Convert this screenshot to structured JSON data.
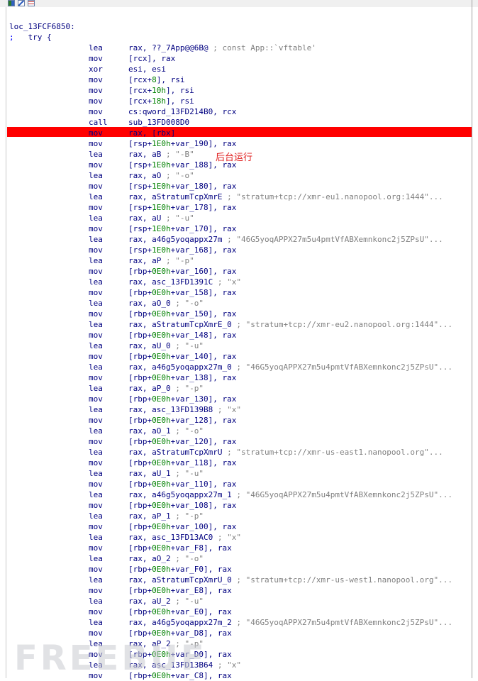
{
  "toolbar": {
    "icons": [
      "graph-view-icon",
      "chart-icon",
      "text-view-icon"
    ]
  },
  "colors": {
    "highlight": "#ff0000",
    "mnemonic": "#000080",
    "number": "#008000",
    "comment": "#808080",
    "annotation": "#e02020"
  },
  "listing": {
    "label": "loc_13FCF6850:",
    "try_semicolon": ";",
    "try_text": "try {",
    "instructions": [
      {
        "mn": "lea",
        "op": "rax, ??_7App@@6B@",
        "cmt": " ; const App::`vftable'"
      },
      {
        "mn": "mov",
        "op": "[rcx], rax",
        "cmt": ""
      },
      {
        "mn": "xor",
        "op": "esi, esi",
        "cmt": ""
      },
      {
        "mn": "mov",
        "op": "[rcx+8], rsi",
        "cmt": ""
      },
      {
        "mn": "mov",
        "op": "[rcx+10h], rsi",
        "cmt": ""
      },
      {
        "mn": "mov",
        "op": "[rcx+18h], rsi",
        "cmt": ""
      },
      {
        "mn": "mov",
        "op": "cs:qword_13FD214B0, rcx",
        "cmt": ""
      },
      {
        "mn": "call",
        "op": "sub_13FD008D0",
        "cmt": ""
      },
      {
        "mn": "mov",
        "op": "rax, [rbx]",
        "cmt": ""
      },
      {
        "mn": "mov",
        "op": "[rsp+1E0h+var_190], rax",
        "cmt": ""
      },
      {
        "mn": "lea",
        "op": "rax, aB",
        "cmt": " ; \"-B\""
      },
      {
        "mn": "mov",
        "op": "[rsp+1E0h+var_188], rax",
        "cmt": ""
      },
      {
        "mn": "lea",
        "op": "rax, aO",
        "cmt": " ; \"-o\""
      },
      {
        "mn": "mov",
        "op": "[rsp+1E0h+var_180], rax",
        "cmt": ""
      },
      {
        "mn": "lea",
        "op": "rax, aStratumTcpXmrE",
        "cmt": " ; \"stratum+tcp://xmr-eu1.nanopool.org:1444\"..."
      },
      {
        "mn": "mov",
        "op": "[rsp+1E0h+var_178], rax",
        "cmt": ""
      },
      {
        "mn": "lea",
        "op": "rax, aU",
        "cmt": " ; \"-u\""
      },
      {
        "mn": "mov",
        "op": "[rsp+1E0h+var_170], rax",
        "cmt": ""
      },
      {
        "mn": "lea",
        "op": "rax, a46g5yoqappx27m",
        "cmt": " ; \"46G5yoqAPPX27m5u4pmtVfABXemnkonc2j5ZPsU\"..."
      },
      {
        "mn": "mov",
        "op": "[rsp+1E0h+var_168], rax",
        "cmt": ""
      },
      {
        "mn": "lea",
        "op": "rax, aP",
        "cmt": " ; \"-p\""
      },
      {
        "mn": "mov",
        "op": "[rbp+0E0h+var_160], rax",
        "cmt": ""
      },
      {
        "mn": "lea",
        "op": "rax, asc_13FD1391C",
        "cmt": " ; \"x\""
      },
      {
        "mn": "mov",
        "op": "[rbp+0E0h+var_158], rax",
        "cmt": ""
      },
      {
        "mn": "lea",
        "op": "rax, aO_0",
        "cmt": " ; \"-o\""
      },
      {
        "mn": "mov",
        "op": "[rbp+0E0h+var_150], rax",
        "cmt": ""
      },
      {
        "mn": "lea",
        "op": "rax, aStratumTcpXmrE_0",
        "cmt": " ; \"stratum+tcp://xmr-eu2.nanopool.org:1444\"..."
      },
      {
        "mn": "mov",
        "op": "[rbp+0E0h+var_148], rax",
        "cmt": ""
      },
      {
        "mn": "lea",
        "op": "rax, aU_0",
        "cmt": " ; \"-u\""
      },
      {
        "mn": "mov",
        "op": "[rbp+0E0h+var_140], rax",
        "cmt": ""
      },
      {
        "mn": "lea",
        "op": "rax, a46g5yoqappx27m_0",
        "cmt": " ; \"46G5yoqAPPX27m5u4pmtVfABXemnkonc2j5ZPsU\"..."
      },
      {
        "mn": "mov",
        "op": "[rbp+0E0h+var_138], rax",
        "cmt": ""
      },
      {
        "mn": "lea",
        "op": "rax, aP_0",
        "cmt": " ; \"-p\""
      },
      {
        "mn": "mov",
        "op": "[rbp+0E0h+var_130], rax",
        "cmt": ""
      },
      {
        "mn": "lea",
        "op": "rax, asc_13FD139B8",
        "cmt": " ; \"x\""
      },
      {
        "mn": "mov",
        "op": "[rbp+0E0h+var_128], rax",
        "cmt": ""
      },
      {
        "mn": "lea",
        "op": "rax, aO_1",
        "cmt": " ; \"-o\""
      },
      {
        "mn": "mov",
        "op": "[rbp+0E0h+var_120], rax",
        "cmt": ""
      },
      {
        "mn": "lea",
        "op": "rax, aStratumTcpXmrU",
        "cmt": " ; \"stratum+tcp://xmr-us-east1.nanopool.org\"..."
      },
      {
        "mn": "mov",
        "op": "[rbp+0E0h+var_118], rax",
        "cmt": ""
      },
      {
        "mn": "lea",
        "op": "rax, aU_1",
        "cmt": " ; \"-u\""
      },
      {
        "mn": "mov",
        "op": "[rbp+0E0h+var_110], rax",
        "cmt": ""
      },
      {
        "mn": "lea",
        "op": "rax, a46g5yoqappx27m_1",
        "cmt": " ; \"46G5yoqAPPX27m5u4pmtVfABXemnkonc2j5ZPsU\"..."
      },
      {
        "mn": "mov",
        "op": "[rbp+0E0h+var_108], rax",
        "cmt": ""
      },
      {
        "mn": "lea",
        "op": "rax, aP_1",
        "cmt": " ; \"-p\""
      },
      {
        "mn": "mov",
        "op": "[rbp+0E0h+var_100], rax",
        "cmt": ""
      },
      {
        "mn": "lea",
        "op": "rax, asc_13FD13AC0",
        "cmt": " ; \"x\""
      },
      {
        "mn": "mov",
        "op": "[rbp+0E0h+var_F8], rax",
        "cmt": ""
      },
      {
        "mn": "lea",
        "op": "rax, aO_2",
        "cmt": " ; \"-o\""
      },
      {
        "mn": "mov",
        "op": "[rbp+0E0h+var_F0], rax",
        "cmt": ""
      },
      {
        "mn": "lea",
        "op": "rax, aStratumTcpXmrU_0",
        "cmt": " ; \"stratum+tcp://xmr-us-west1.nanopool.org\"..."
      },
      {
        "mn": "mov",
        "op": "[rbp+0E0h+var_E8], rax",
        "cmt": ""
      },
      {
        "mn": "lea",
        "op": "rax, aU_2",
        "cmt": " ; \"-u\""
      },
      {
        "mn": "mov",
        "op": "[rbp+0E0h+var_E0], rax",
        "cmt": ""
      },
      {
        "mn": "lea",
        "op": "rax, a46g5yoqappx27m_2",
        "cmt": " ; \"46G5yoqAPPX27m5u4pmtVfABXemnkonc2j5ZPsU\"..."
      },
      {
        "mn": "mov",
        "op": "[rbp+0E0h+var_D8], rax",
        "cmt": ""
      },
      {
        "mn": "lea",
        "op": "rax, aP_2",
        "cmt": " ; \"-p\""
      },
      {
        "mn": "mov",
        "op": "[rbp+0E0h+var_D0], rax",
        "cmt": ""
      },
      {
        "mn": "lea",
        "op": "rax, asc_13FD13B64",
        "cmt": " ; \"x\""
      },
      {
        "mn": "mov",
        "op": "[rbp+0E0h+var_C8], rax",
        "cmt": ""
      }
    ],
    "highlighted_index": 8
  },
  "annotation": "后台运行",
  "watermark": "FREEBUF"
}
